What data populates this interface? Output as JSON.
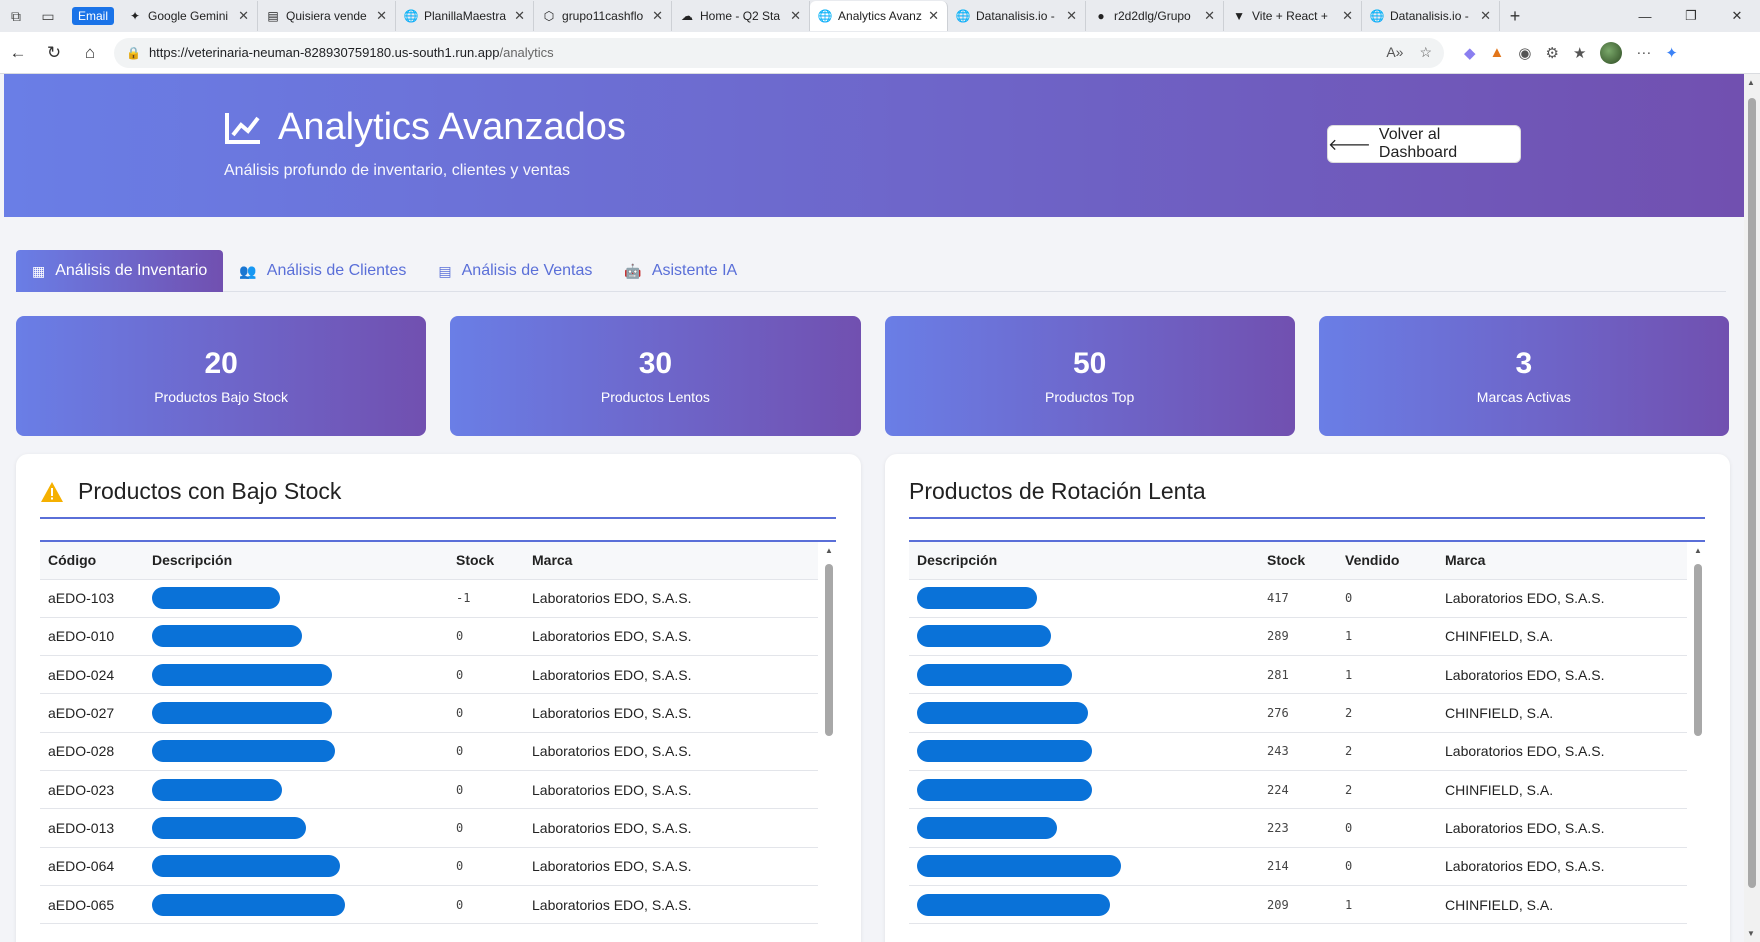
{
  "browser": {
    "email_chip": "Email",
    "tabs": [
      {
        "title": "Google Gemini",
        "icon": "sparkle-icon"
      },
      {
        "title": "Quisiera vende",
        "icon": "doc-icon"
      },
      {
        "title": "PlanillaMaestra",
        "icon": "globe-icon"
      },
      {
        "title": "grupo11cashflo",
        "icon": "cube-icon"
      },
      {
        "title": "Home - Q2 Sta",
        "icon": "cloud-icon"
      },
      {
        "title": "Analytics Avanz",
        "icon": "globe-icon",
        "active": true
      },
      {
        "title": "Datanalisis.io -",
        "icon": "globe-icon"
      },
      {
        "title": "r2d2dlg/Grupo",
        "icon": "github-icon"
      },
      {
        "title": "Vite + React +",
        "icon": "vite-icon"
      },
      {
        "title": "Datanalisis.io -",
        "icon": "globe-icon"
      }
    ],
    "url_host": "https://veterinaria-neuman-828930759180.us-south1.run.app",
    "url_path": "/analytics"
  },
  "header": {
    "title": "Analytics Avanzados",
    "subtitle": "Análisis profundo de inventario, clientes y ventas",
    "back_label": "Volver al Dashboard"
  },
  "tabs": [
    {
      "label": "Análisis de Inventario",
      "active": true
    },
    {
      "label": "Análisis de Clientes"
    },
    {
      "label": "Análisis de Ventas"
    },
    {
      "label": "Asistente IA"
    }
  ],
  "stats": [
    {
      "value": "20",
      "label": "Productos Bajo Stock"
    },
    {
      "value": "30",
      "label": "Productos Lentos"
    },
    {
      "value": "50",
      "label": "Productos Top"
    },
    {
      "value": "3",
      "label": "Marcas Activas"
    }
  ],
  "low_stock": {
    "title": "Productos con Bajo Stock",
    "columns": [
      "Código",
      "Descripción",
      "Stock",
      "Marca"
    ],
    "rows": [
      {
        "code": "aEDO-103",
        "stock": "-1",
        "brand": "Laboratorios EDO, S.A.S."
      },
      {
        "code": "aEDO-010",
        "stock": "0",
        "brand": "Laboratorios EDO, S.A.S."
      },
      {
        "code": "aEDO-024",
        "stock": "0",
        "brand": "Laboratorios EDO, S.A.S."
      },
      {
        "code": "aEDO-027",
        "stock": "0",
        "brand": "Laboratorios EDO, S.A.S."
      },
      {
        "code": "aEDO-028",
        "stock": "0",
        "brand": "Laboratorios EDO, S.A.S."
      },
      {
        "code": "aEDO-023",
        "stock": "0",
        "brand": "Laboratorios EDO, S.A.S."
      },
      {
        "code": "aEDO-013",
        "stock": "0",
        "brand": "Laboratorios EDO, S.A.S."
      },
      {
        "code": "aEDO-064",
        "stock": "0",
        "brand": "Laboratorios EDO, S.A.S."
      },
      {
        "code": "aEDO-065",
        "stock": "0",
        "brand": "Laboratorios EDO, S.A.S."
      }
    ]
  },
  "slow_rotation": {
    "title": "Productos de Rotación Lenta",
    "columns": [
      "Descripción",
      "Stock",
      "Vendido",
      "Marca"
    ],
    "rows": [
      {
        "stock": "417",
        "sold": "0",
        "brand": "Laboratorios EDO, S.A.S."
      },
      {
        "stock": "289",
        "sold": "1",
        "brand": "CHINFIELD, S.A."
      },
      {
        "stock": "281",
        "sold": "1",
        "brand": "Laboratorios EDO, S.A.S."
      },
      {
        "stock": "276",
        "sold": "2",
        "brand": "CHINFIELD, S.A."
      },
      {
        "stock": "243",
        "sold": "2",
        "brand": "Laboratorios EDO, S.A.S."
      },
      {
        "stock": "224",
        "sold": "2",
        "brand": "CHINFIELD, S.A."
      },
      {
        "stock": "223",
        "sold": "0",
        "brand": "Laboratorios EDO, S.A.S."
      },
      {
        "stock": "214",
        "sold": "0",
        "brand": "Laboratorios EDO, S.A.S."
      },
      {
        "stock": "209",
        "sold": "1",
        "brand": "CHINFIELD, S.A."
      }
    ]
  },
  "colors": {
    "accent": "#5a6fd8",
    "gradient_start": "#6a7ee6",
    "gradient_end": "#7150b0",
    "redaction": "#0a72d8"
  }
}
